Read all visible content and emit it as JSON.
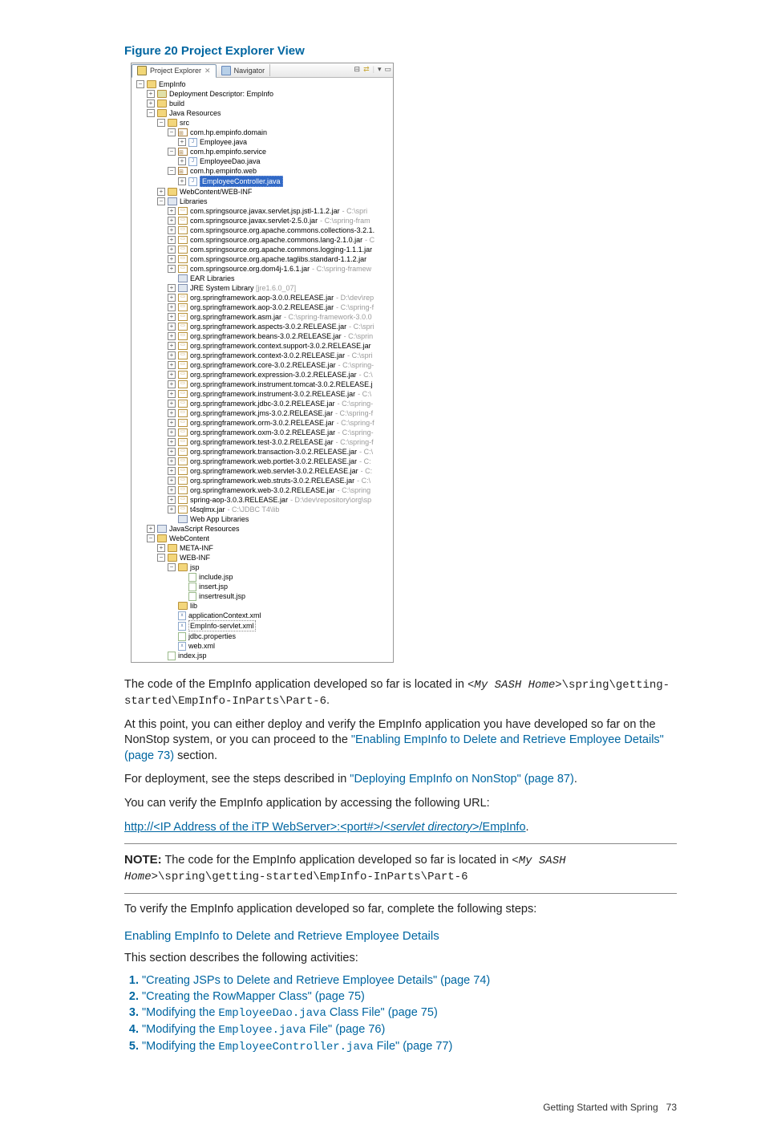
{
  "figure_title": "Figure 20 Project Explorer View",
  "tabs": {
    "active": "Project Explorer",
    "other": "Navigator"
  },
  "tree": [
    {
      "depth": 0,
      "exp": "-",
      "icon": "proj",
      "text": "EmpInfo"
    },
    {
      "depth": 1,
      "exp": "+",
      "icon": "dd",
      "text": "Deployment Descriptor: EmpInfo"
    },
    {
      "depth": 1,
      "exp": "+",
      "icon": "folder-open",
      "text": "build"
    },
    {
      "depth": 1,
      "exp": "-",
      "icon": "java-res",
      "text": "Java Resources"
    },
    {
      "depth": 2,
      "exp": "-",
      "icon": "src",
      "text": "src"
    },
    {
      "depth": 3,
      "exp": "-",
      "icon": "pkg",
      "text": "com.hp.empinfo.domain"
    },
    {
      "depth": 4,
      "exp": "+",
      "icon": "java",
      "text": "Employee.java"
    },
    {
      "depth": 3,
      "exp": "-",
      "icon": "pkg",
      "text": "com.hp.empinfo.service"
    },
    {
      "depth": 4,
      "exp": "+",
      "icon": "java",
      "text": "EmployeeDao.java"
    },
    {
      "depth": 3,
      "exp": "-",
      "icon": "pkg",
      "text": "com.hp.empinfo.web"
    },
    {
      "depth": 4,
      "exp": "+",
      "icon": "java",
      "text": "EmployeeController.java",
      "selected": true
    },
    {
      "depth": 2,
      "exp": "+",
      "icon": "folder",
      "text": "WebContent/WEB-INF"
    },
    {
      "depth": 2,
      "exp": "-",
      "icon": "lib",
      "text": "Libraries"
    },
    {
      "depth": 3,
      "exp": "+",
      "icon": "jar",
      "text": "com.springsource.javax.servlet.jsp.jstl-1.1.2.jar",
      "suffix": " - C:\\spri"
    },
    {
      "depth": 3,
      "exp": "+",
      "icon": "jar",
      "text": "com.springsource.javax.servlet-2.5.0.jar",
      "suffix": " - C:\\spring-fram"
    },
    {
      "depth": 3,
      "exp": "+",
      "icon": "jar",
      "text": "com.springsource.org.apache.commons.collections-3.2.1."
    },
    {
      "depth": 3,
      "exp": "+",
      "icon": "jar",
      "text": "com.springsource.org.apache.commons.lang-2.1.0.jar",
      "suffix": " - C"
    },
    {
      "depth": 3,
      "exp": "+",
      "icon": "jar",
      "text": "com.springsource.org.apache.commons.logging-1.1.1.jar"
    },
    {
      "depth": 3,
      "exp": "+",
      "icon": "jar",
      "text": "com.springsource.org.apache.taglibs.standard-1.1.2.jar"
    },
    {
      "depth": 3,
      "exp": "+",
      "icon": "jar",
      "text": "com.springsource.org.dom4j-1.6.1.jar",
      "suffix": " - C:\\spring-framew"
    },
    {
      "depth": 3,
      "exp": "",
      "icon": "lib",
      "text": "EAR Libraries"
    },
    {
      "depth": 3,
      "exp": "+",
      "icon": "lib",
      "text": "JRE System Library ",
      "jre": "[jre1.6.0_07]"
    },
    {
      "depth": 3,
      "exp": "+",
      "icon": "jar",
      "text": "org.springframework.aop-3.0.0.RELEASE.jar",
      "suffix": " - D:\\dev\\rep"
    },
    {
      "depth": 3,
      "exp": "+",
      "icon": "jar",
      "text": "org.springframework.aop-3.0.2.RELEASE.jar",
      "suffix": " - C:\\spring-f"
    },
    {
      "depth": 3,
      "exp": "+",
      "icon": "jar",
      "text": "org.springframework.asm.jar",
      "suffix": " - C:\\spring-framework-3.0.0"
    },
    {
      "depth": 3,
      "exp": "+",
      "icon": "jar",
      "text": "org.springframework.aspects-3.0.2.RELEASE.jar",
      "suffix": " - C:\\spri"
    },
    {
      "depth": 3,
      "exp": "+",
      "icon": "jar",
      "text": "org.springframework.beans-3.0.2.RELEASE.jar",
      "suffix": " - C:\\sprin"
    },
    {
      "depth": 3,
      "exp": "+",
      "icon": "jar",
      "text": "org.springframework.context.support-3.0.2.RELEASE.jar"
    },
    {
      "depth": 3,
      "exp": "+",
      "icon": "jar",
      "text": "org.springframework.context-3.0.2.RELEASE.jar",
      "suffix": " - C:\\spri"
    },
    {
      "depth": 3,
      "exp": "+",
      "icon": "jar",
      "text": "org.springframework.core-3.0.2.RELEASE.jar",
      "suffix": " - C:\\spring-"
    },
    {
      "depth": 3,
      "exp": "+",
      "icon": "jar",
      "text": "org.springframework.expression-3.0.2.RELEASE.jar",
      "suffix": " - C:\\"
    },
    {
      "depth": 3,
      "exp": "+",
      "icon": "jar",
      "text": "org.springframework.instrument.tomcat-3.0.2.RELEASE.j"
    },
    {
      "depth": 3,
      "exp": "+",
      "icon": "jar",
      "text": "org.springframework.instrument-3.0.2.RELEASE.jar",
      "suffix": " - C:\\"
    },
    {
      "depth": 3,
      "exp": "+",
      "icon": "jar",
      "text": "org.springframework.jdbc-3.0.2.RELEASE.jar",
      "suffix": " - C:\\spring-"
    },
    {
      "depth": 3,
      "exp": "+",
      "icon": "jar",
      "text": "org.springframework.jms-3.0.2.RELEASE.jar",
      "suffix": " - C:\\spring-f"
    },
    {
      "depth": 3,
      "exp": "+",
      "icon": "jar",
      "text": "org.springframework.orm-3.0.2.RELEASE.jar",
      "suffix": " - C:\\spring-f"
    },
    {
      "depth": 3,
      "exp": "+",
      "icon": "jar",
      "text": "org.springframework.oxm-3.0.2.RELEASE.jar",
      "suffix": " - C:\\spring-"
    },
    {
      "depth": 3,
      "exp": "+",
      "icon": "jar",
      "text": "org.springframework.test-3.0.2.RELEASE.jar",
      "suffix": " - C:\\spring-f"
    },
    {
      "depth": 3,
      "exp": "+",
      "icon": "jar",
      "text": "org.springframework.transaction-3.0.2.RELEASE.jar",
      "suffix": " - C:\\"
    },
    {
      "depth": 3,
      "exp": "+",
      "icon": "jar",
      "text": "org.springframework.web.portlet-3.0.2.RELEASE.jar",
      "suffix": " - C:"
    },
    {
      "depth": 3,
      "exp": "+",
      "icon": "jar",
      "text": "org.springframework.web.servlet-3.0.2.RELEASE.jar",
      "suffix": " - C:"
    },
    {
      "depth": 3,
      "exp": "+",
      "icon": "jar",
      "text": "org.springframework.web.struts-3.0.2.RELEASE.jar",
      "suffix": " - C:\\"
    },
    {
      "depth": 3,
      "exp": "+",
      "icon": "jar",
      "text": "org.springframework.web-3.0.2.RELEASE.jar",
      "suffix": " - C:\\spring"
    },
    {
      "depth": 3,
      "exp": "+",
      "icon": "jar",
      "text": "spring-aop-3.0.3.RELEASE.jar",
      "suffix": " - D:\\dev\\repository\\org\\sp"
    },
    {
      "depth": 3,
      "exp": "+",
      "icon": "jar",
      "text": "t4sqlmx.jar",
      "suffix": " - C:\\JDBC T4\\lib"
    },
    {
      "depth": 3,
      "exp": "",
      "icon": "lib",
      "text": "Web App Libraries"
    },
    {
      "depth": 1,
      "exp": "+",
      "icon": "lib",
      "text": "JavaScript Resources"
    },
    {
      "depth": 1,
      "exp": "-",
      "icon": "folder-open",
      "text": "WebContent"
    },
    {
      "depth": 2,
      "exp": "+",
      "icon": "folder-open",
      "text": "META-INF"
    },
    {
      "depth": 2,
      "exp": "-",
      "icon": "folder-open",
      "text": "WEB-INF"
    },
    {
      "depth": 3,
      "exp": "-",
      "icon": "folder-open",
      "text": "jsp"
    },
    {
      "depth": 4,
      "exp": "",
      "icon": "file",
      "text": "include.jsp"
    },
    {
      "depth": 4,
      "exp": "",
      "icon": "file",
      "text": "insert.jsp"
    },
    {
      "depth": 4,
      "exp": "",
      "icon": "file",
      "text": "insertresult.jsp"
    },
    {
      "depth": 3,
      "exp": "",
      "icon": "folder-open",
      "text": "lib"
    },
    {
      "depth": 3,
      "exp": "",
      "icon": "xml",
      "text": "applicationContext.xml"
    },
    {
      "depth": 3,
      "exp": "",
      "icon": "xml",
      "text": "EmpInfo-servlet.xml",
      "boxed": true
    },
    {
      "depth": 3,
      "exp": "",
      "icon": "file",
      "text": "jdbc.properties"
    },
    {
      "depth": 3,
      "exp": "",
      "icon": "xml",
      "text": "web.xml"
    },
    {
      "depth": 2,
      "exp": "",
      "icon": "file",
      "text": "index.jsp"
    }
  ],
  "paragraphs": {
    "p1_a": "The code of the EmpInfo application developed so far is located in ",
    "p1_code1": "<My SASH Home>",
    "p1_code2": "\\spring\\getting-started\\EmpInfo-InParts\\Part-6",
    "p1_b": ".",
    "p2_a": "At this point, you can either deploy and verify the EmpInfo application you have developed so far on the NonStop system, or you can proceed to the ",
    "p2_link": "\"Enabling EmpInfo to Delete and Retrieve Employee Details\" (page 73)",
    "p2_b": " section.",
    "p3_a": "For deployment, see the steps described in ",
    "p3_link": "\"Deploying EmpInfo on NonStop\" (page 87)",
    "p3_b": ".",
    "p4": "You can verify the EmpInfo application by accessing the following URL:",
    "url_a": "http://<IP Address of the iTP WebServer>:<port#>/<",
    "url_ital": "servlet directory",
    "url_b": ">/EmpInfo",
    "url_dot": ".",
    "note_label": "NOTE:",
    "note_a": "   The code for the EmpInfo application developed so far is located in ",
    "note_code1": "<My SASH Home>",
    "note_code2": "\\spring\\getting-started\\EmpInfo-InParts\\Part-6",
    "p5": "To verify the EmpInfo application developed so far, complete the following steps:",
    "h1": "Enabling EmpInfo to Delete and Retrieve Employee Details",
    "p6": "This section describes the following activities:"
  },
  "steps": [
    {
      "pre": "",
      "link": "\"Creating JSPs to Delete and Retrieve Employee Details\" (page 74)",
      "post": ""
    },
    {
      "pre": "",
      "link": "\"Creating the RowMapper Class\" (page 75)",
      "post": ""
    },
    {
      "pre": "\"Modifying the ",
      "code": "EmployeeDao.java",
      "post": " Class File\" (page 75)"
    },
    {
      "pre": "\"Modifying the ",
      "code": "Employee.java",
      "post": " File\" (page 76)"
    },
    {
      "pre": "\"Modifying the ",
      "code": "EmployeeController.java",
      "post": " File\" (page 77)"
    }
  ],
  "footer": {
    "text": "Getting Started with Spring",
    "page": "73"
  }
}
